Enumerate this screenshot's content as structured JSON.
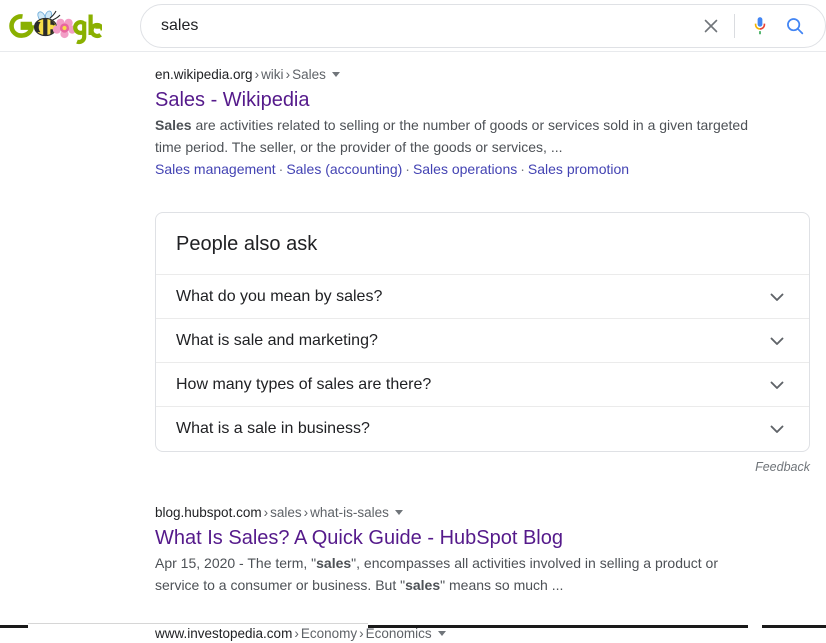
{
  "header": {
    "logo_alt": "google-doodle-bee",
    "search": {
      "value": "sales",
      "placeholder": "Search",
      "clear_label": "Clear",
      "mic_label": "Search by voice",
      "submit_label": "Google Search"
    }
  },
  "results": [
    {
      "crumb": {
        "host": "en.wikipedia.org",
        "segments": [
          "wiki",
          "Sales"
        ]
      },
      "title": "Sales - Wikipedia",
      "snippet_parts": [
        {
          "text": "Sales",
          "bold": true
        },
        {
          "text": " are activities related to selling or the number of goods or services sold in a given targeted time period. The seller, or the provider of the goods or services, ...",
          "bold": false
        }
      ],
      "sitelinks": [
        "Sales management",
        "Sales (accounting)",
        "Sales operations",
        "Sales promotion"
      ]
    },
    {
      "crumb": {
        "host": "blog.hubspot.com",
        "segments": [
          "sales",
          "what-is-sales"
        ]
      },
      "title": "What Is Sales? A Quick Guide - HubSpot Blog",
      "snippet_parts": [
        {
          "text": "Apr 15, 2020 - The term, \"",
          "bold": false
        },
        {
          "text": "sales",
          "bold": true
        },
        {
          "text": "\", encompasses all activities involved in selling a product or service to a consumer or business. But \"",
          "bold": false
        },
        {
          "text": "sales",
          "bold": true
        },
        {
          "text": "\" means so much ...",
          "bold": false
        }
      ],
      "sitelinks": []
    },
    {
      "crumb": {
        "host": "www.investopedia.com",
        "segments": [
          "Economy",
          "Economics"
        ]
      },
      "title": "",
      "snippet_parts": [],
      "sitelinks": []
    }
  ],
  "people_also_ask": {
    "title": "People also ask",
    "questions": [
      "What do you mean by sales?",
      "What is sale and marketing?",
      "How many types of sales are there?",
      "What is a sale in business?"
    ],
    "feedback_label": "Feedback"
  },
  "colors": {
    "link_visited": "#551a8b",
    "sitelink": "#4343b3",
    "snippet_text": "#4d5156",
    "crumb_text": "#202124",
    "google_green": "#8ab000",
    "flower_pink": "#ef8bbd",
    "mic_blue": "#4285f4",
    "mic_red": "#ea4335",
    "search_blue": "#4285f4"
  }
}
